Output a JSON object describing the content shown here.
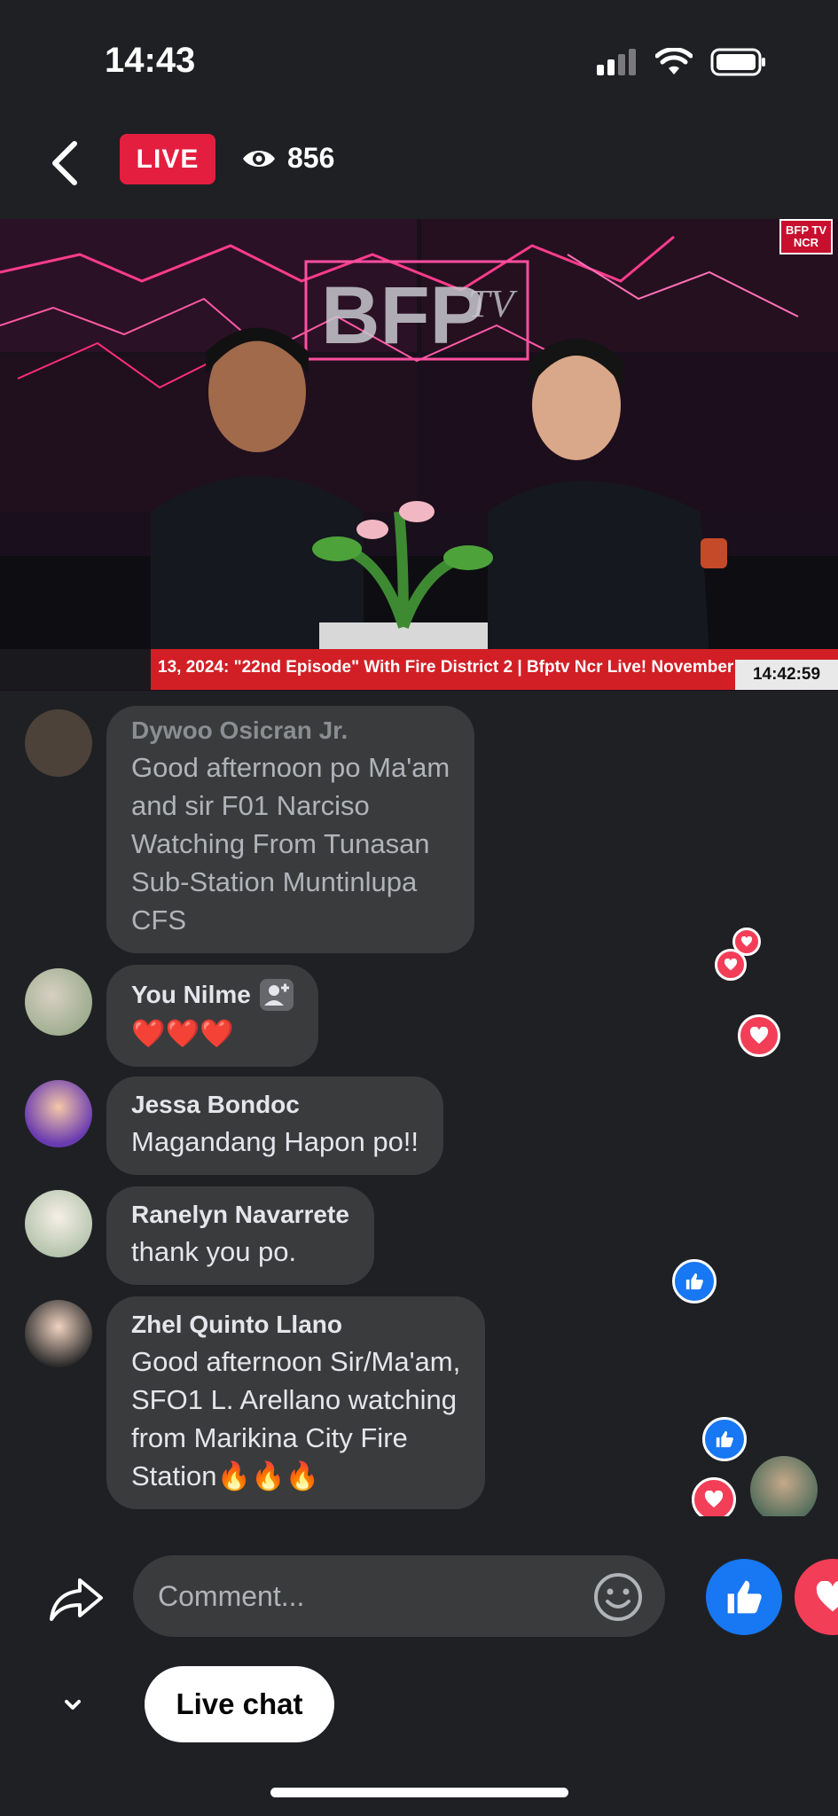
{
  "status_bar": {
    "time": "14:43"
  },
  "top_bar": {
    "live_label": "LIVE",
    "viewer_count": "856"
  },
  "video": {
    "corner_logo": "BFP TV NCR",
    "ticker_text": "13, 2024:  \"22nd Episode\" With Fire District 2  |  Bfptv Ncr Live! November",
    "clock": "14:42:59"
  },
  "comments": [
    {
      "author": "Dywoo Osicran Jr.",
      "message": "Good afternoon po Ma'am\nand sir F01 Narciso\nWatching From Tunasan\nSub-Station Muntinlupa\nCFS",
      "faded": true
    },
    {
      "author": "You Nilme",
      "message": "❤️❤️❤️",
      "badge": "profile-badge-icon"
    },
    {
      "author": "Jessa Bondoc",
      "message": "Magandang Hapon po!!"
    },
    {
      "author": "Ranelyn Navarrete",
      "message": "thank you po."
    },
    {
      "author": "Zhel Quinto Llano",
      "message": "Good afternoon Sir/Ma'am,\nSFO1 L. Arellano watching\nfrom Marikina City Fire\nStation🔥🔥🔥"
    }
  ],
  "composer": {
    "placeholder": "Comment..."
  },
  "bottom_bar": {
    "live_chat_label": "Live chat"
  },
  "colors": {
    "live_red": "#e41e3f",
    "like_blue": "#1877f2",
    "heart_red": "#f33e58",
    "bubble": "#3a3b3c"
  }
}
